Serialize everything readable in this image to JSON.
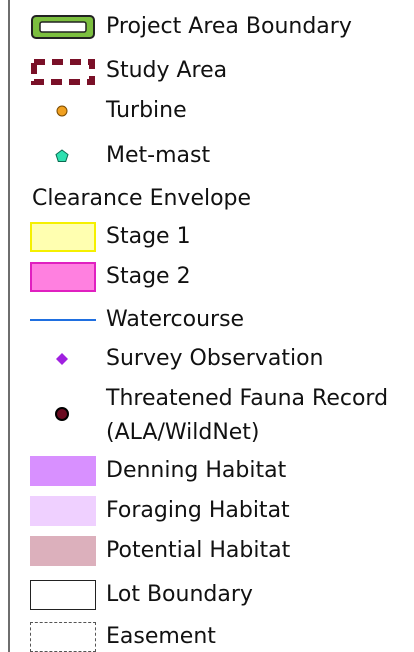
{
  "legend": {
    "items": [
      {
        "label": "Project Area Boundary",
        "color": "#7cbf3f"
      },
      {
        "label": "Study Area",
        "color": "#7a1028"
      },
      {
        "label": "Turbine",
        "color": "#f0a020"
      },
      {
        "label": "Met-mast",
        "color": "#2ee0b0"
      },
      {
        "label": "Clearance Envelope"
      },
      {
        "label": "Stage 1",
        "color": "#ffffb0"
      },
      {
        "label": "Stage 2",
        "color": "#ff80e0"
      },
      {
        "label": "Watercourse",
        "color": "#1f6fe0"
      },
      {
        "label": "Survey Observation",
        "color": "#a020e0"
      },
      {
        "label_line1": "Threatened Fauna Record",
        "label_line2": "(ALA/WildNet)",
        "color": "#6a0a20"
      },
      {
        "label": "Denning Habitat",
        "color": "#d890ff"
      },
      {
        "label": "Foraging Habitat",
        "color": "#efd0ff"
      },
      {
        "label": "Potential Habitat",
        "color": "#dcb0bc"
      },
      {
        "label": "Lot Boundary"
      },
      {
        "label": "Easement"
      }
    ]
  }
}
